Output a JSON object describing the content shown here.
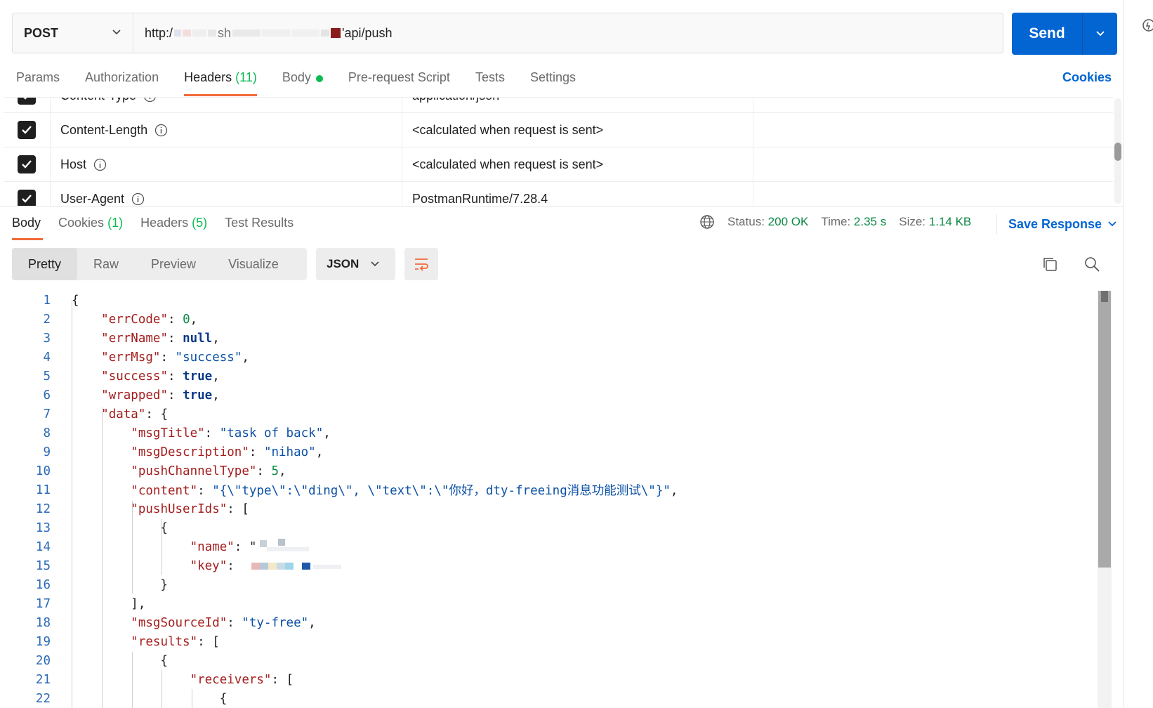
{
  "request": {
    "method": "POST",
    "url_start": "http:/",
    "url_mid": "sh",
    "url_end": "'api/push",
    "send_label": "Send"
  },
  "request_tabs": {
    "params": "Params",
    "authorization": "Authorization",
    "headers": "Headers",
    "headers_count": "(11)",
    "body": "Body",
    "prerequest": "Pre-request Script",
    "tests": "Tests",
    "settings": "Settings",
    "cookies": "Cookies"
  },
  "headers_rows": [
    {
      "key": "Content-Type",
      "value": "application/json"
    },
    {
      "key": "Content-Length",
      "value": "<calculated when request is sent>"
    },
    {
      "key": "Host",
      "value": "<calculated when request is sent>"
    },
    {
      "key": "User-Agent",
      "value": "PostmanRuntime/7.28.4"
    }
  ],
  "response_tabs": {
    "body": "Body",
    "cookies": "Cookies",
    "cookies_count": "(1)",
    "headers": "Headers",
    "headers_count": "(5)",
    "test_results": "Test Results"
  },
  "response_meta": {
    "status_label": "Status:",
    "status_value": "200 OK",
    "time_label": "Time:",
    "time_value": "2.35 s",
    "size_label": "Size:",
    "size_value": "1.14 KB",
    "save_response": "Save Response"
  },
  "format": {
    "pretty": "Pretty",
    "raw": "Raw",
    "preview": "Preview",
    "visualize": "Visualize",
    "language": "JSON"
  },
  "code_lines": [
    {
      "n": "1",
      "t": "{"
    },
    {
      "n": "2",
      "t": "    \"errCode\": 0,"
    },
    {
      "n": "3",
      "t": "    \"errName\": null,"
    },
    {
      "n": "4",
      "t": "    \"errMsg\": \"success\","
    },
    {
      "n": "5",
      "t": "    \"success\": true,"
    },
    {
      "n": "6",
      "t": "    \"wrapped\": true,"
    },
    {
      "n": "7",
      "t": "    \"data\": {"
    },
    {
      "n": "8",
      "t": "        \"msgTitle\": \"task of back\","
    },
    {
      "n": "9",
      "t": "        \"msgDescription\": \"nihao\","
    },
    {
      "n": "10",
      "t": "        \"pushChannelType\": 5,"
    },
    {
      "n": "11",
      "t": "        \"content\": \"{\\\"type\\\":\\\"ding\\\", \\\"text\\\":\\\"你好，dty-freeing消息功能测试\\\"}\","
    },
    {
      "n": "12",
      "t": "        \"pushUserIds\": ["
    },
    {
      "n": "13",
      "t": "            {"
    },
    {
      "n": "14",
      "t": "                \"name\": \""
    },
    {
      "n": "15",
      "t": "                \"key\": "
    },
    {
      "n": "16",
      "t": "            }"
    },
    {
      "n": "17",
      "t": "        ],"
    },
    {
      "n": "18",
      "t": "        \"msgSourceId\": \"ty-free\","
    },
    {
      "n": "19",
      "t": "        \"results\": ["
    },
    {
      "n": "20",
      "t": "            {"
    },
    {
      "n": "21",
      "t": "                \"receivers\": ["
    },
    {
      "n": "22",
      "t": "                    {"
    }
  ],
  "colors": {
    "accent": "#0265d2",
    "tab_underline": "#f26b3a",
    "status_green": "#0b8a43",
    "json_key": "#a41d1d",
    "json_string": "#0b50a5"
  }
}
